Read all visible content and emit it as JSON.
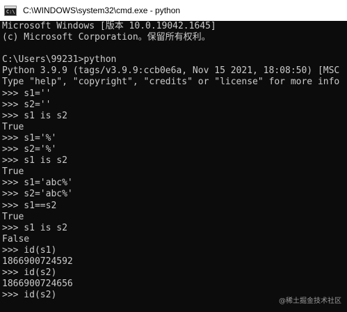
{
  "window": {
    "title": "C:\\WINDOWS\\system32\\cmd.exe - python",
    "icon": "cmd-icon",
    "icon_glyph": "C:\\"
  },
  "console": {
    "lines": [
      "Microsoft Windows [版本 10.0.19042.1645]",
      "(c) Microsoft Corporation。保留所有权利。",
      "",
      "C:\\Users\\99231>python",
      "Python 3.9.9 (tags/v3.9.9:ccb0e6a, Nov 15 2021, 18:08:50) [MSC",
      "Type \"help\", \"copyright\", \"credits\" or \"license\" for more info",
      ">>> s1=''",
      ">>> s2=''",
      ">>> s1 is s2",
      "True",
      ">>> s1='%'",
      ">>> s2='%'",
      ">>> s1 is s2",
      "True",
      ">>> s1='abc%'",
      ">>> s2='abc%'",
      ">>> s1==s2",
      "True",
      ">>> s1 is s2",
      "False",
      ">>> id(s1)",
      "1866900724592",
      ">>> id(s2)",
      "1866900724656",
      ">>> id(s2)"
    ]
  },
  "watermark": "@稀土掘金技术社区",
  "colors": {
    "console_bg": "#0c0c0c",
    "console_fg": "#cccccc",
    "titlebar_bg": "#ffffff"
  }
}
